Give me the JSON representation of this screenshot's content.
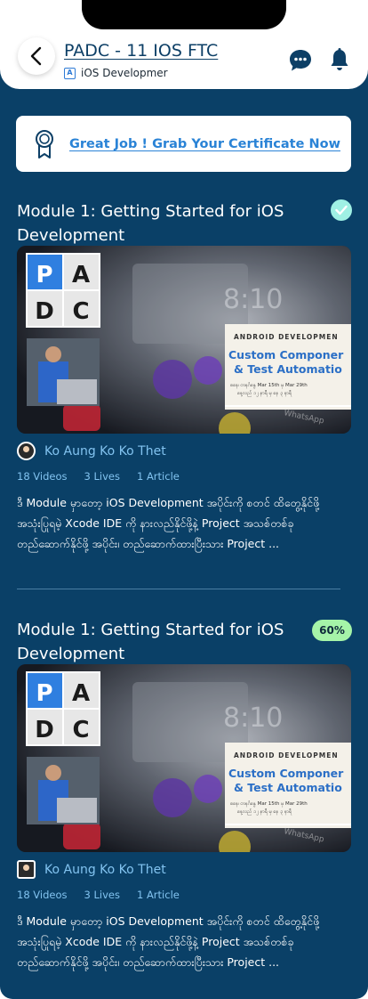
{
  "header": {
    "title": "PADC - 11 IOS FTC",
    "subtitle": "iOS Developmer",
    "back_icon": "chevron-left-icon",
    "chat_icon": "chat-bubble-icon",
    "notification_icon": "bell-icon"
  },
  "certificate": {
    "text": "Great Job ! Grab Your Certificate Now",
    "icon": "award-ribbon-icon"
  },
  "thumbnail": {
    "logo": [
      "P",
      "A",
      "D",
      "C"
    ],
    "banner_heading": "ANDROID DEVELOPMEN",
    "banner_title_1": "Custom Componer",
    "banner_title_2": "& Test Automatio",
    "banner_line_1": "စနေ၊ တနင်္ဂနွေ Mar 15th မှ Mar 29th",
    "banner_line_2": "နေ့လည် ၁၂ နာရီ မှ နေ ၃ နာရီ",
    "phone_text": "8:10",
    "app_label": "WhatsApp"
  },
  "modules": [
    {
      "title": "Module 1: Getting Started for iOS Development",
      "status": "completed",
      "author": "Ko Aung Ko Ko Thet",
      "videos": "18 Videos",
      "lives": "3 Lives",
      "articles": "1 Article",
      "description": "ဒီ Module မှာတော့ iOS Development အပိုင်းကို စတင် ထိတွေ့နိုင်ဖို့ အသုံးပြုရမဲ့ Xcode IDE ကို နားလည်နိုင်ဖို့နဲ့ Project အသစ်တစ်ခု တည်ဆောက်နိုင်ဖို့ အပိုင်း၊ တည်ဆောက်ထားပြီးသား Project ..."
    },
    {
      "title": "Module 1: Getting Started for iOS Development",
      "status": "60%",
      "progress": 0.6,
      "author": "Ko Aung Ko Ko Thet",
      "videos": "18 Videos",
      "lives": "3 Lives",
      "articles": "1 Article",
      "description": "ဒီ Module မှာတော့ iOS Development အပိုင်းကို စတင် ထိတွေ့နိုင်ဖို့ အသုံးပြုရမဲ့ Xcode IDE ကို နားလည်နိုင်ဖို့နဲ့ Project အသစ်တစ်ခု တည်ဆောက်နိုင်ဖို့ အပိုင်း၊ တည်ဆောက်ထားပြီးသား Project ..."
    }
  ],
  "colors": {
    "background": "#0a4067",
    "accent": "#2a83d6",
    "completed": "#9ff0e4",
    "progress": "#a5f4a8"
  }
}
